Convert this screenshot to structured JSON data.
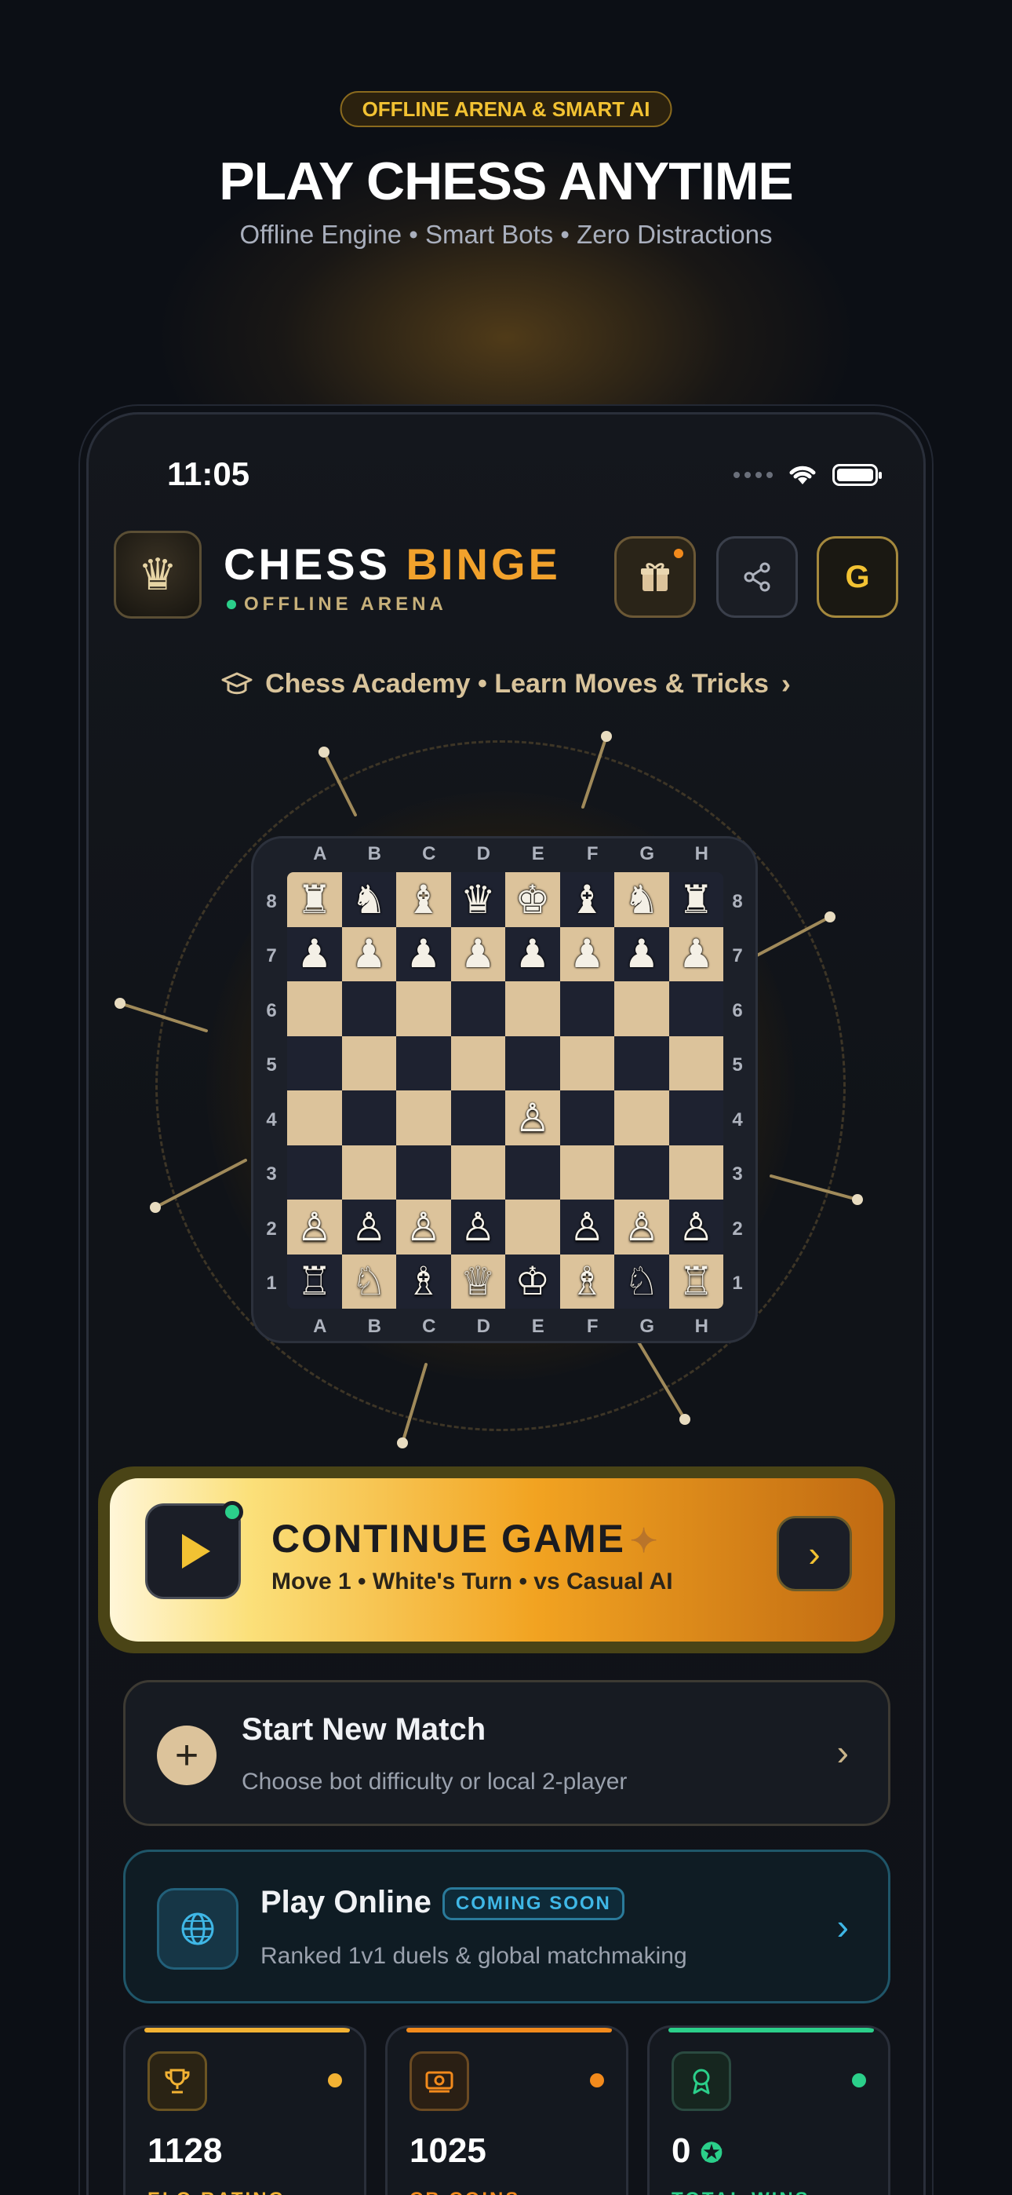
{
  "hero": {
    "badge": "OFFLINE ARENA & SMART AI",
    "title": "PLAY CHESS ANYTIME",
    "subtitle": "Offline Engine • Smart Bots • Zero Distractions"
  },
  "status_bar": {
    "time": "11:05"
  },
  "header": {
    "brand_first": "CHESS",
    "brand_second": "BINGE",
    "brand_subtitle": "OFFLINE ARENA",
    "avatar_initial": "G",
    "icons": [
      "gift-icon",
      "share-icon"
    ]
  },
  "academy_link": {
    "label": "Chess Academy • Learn Moves & Tricks"
  },
  "board": {
    "files": [
      "A",
      "B",
      "C",
      "D",
      "E",
      "F",
      "G",
      "H"
    ],
    "ranks": [
      "8",
      "7",
      "6",
      "5",
      "4",
      "3",
      "2",
      "1"
    ],
    "position": [
      [
        "♜",
        "♞",
        "♝",
        "♛",
        "♚",
        "♝",
        "♞",
        "♜"
      ],
      [
        "♟",
        "♟",
        "♟",
        "♟",
        "♟",
        "♟",
        "♟",
        "♟"
      ],
      [
        "",
        "",
        "",
        "",
        "",
        "",
        "",
        ""
      ],
      [
        "",
        "",
        "",
        "",
        "",
        "",
        "",
        ""
      ],
      [
        "",
        "",
        "",
        "",
        "♙",
        "",
        "",
        ""
      ],
      [
        "",
        "",
        "",
        "",
        "",
        "",
        "",
        ""
      ],
      [
        "♙",
        "♙",
        "♙",
        "♙",
        "",
        "♙",
        "♙",
        "♙"
      ],
      [
        "♖",
        "♘",
        "♗",
        "♕",
        "♔",
        "♗",
        "♘",
        "♖"
      ]
    ]
  },
  "continue_game": {
    "title": "CONTINUE GAME",
    "subtitle": "Move 1 • White's Turn • vs Casual AI"
  },
  "start_new": {
    "title": "Start New Match",
    "subtitle": "Choose bot difficulty or local 2-player"
  },
  "play_online": {
    "title": "Play Online",
    "badge": "COMING SOON",
    "subtitle": "Ranked 1v1 duels & global matchmaking"
  },
  "stats": [
    {
      "value": "1128",
      "label": "ELO RATING",
      "color": "#f2b233",
      "icon": "trophy-icon"
    },
    {
      "value": "1025",
      "label": "CB COINS",
      "color": "#f28a1c",
      "icon": "coins-icon"
    },
    {
      "value": "0",
      "label": "TOTAL WINS",
      "color": "#2bcf8a",
      "icon": "award-icon"
    }
  ],
  "colors": {
    "accent_gold": "#f2c233",
    "accent_orange": "#f2a22c",
    "success_green": "#2bcf8a",
    "info_blue": "#3fb7e6"
  }
}
